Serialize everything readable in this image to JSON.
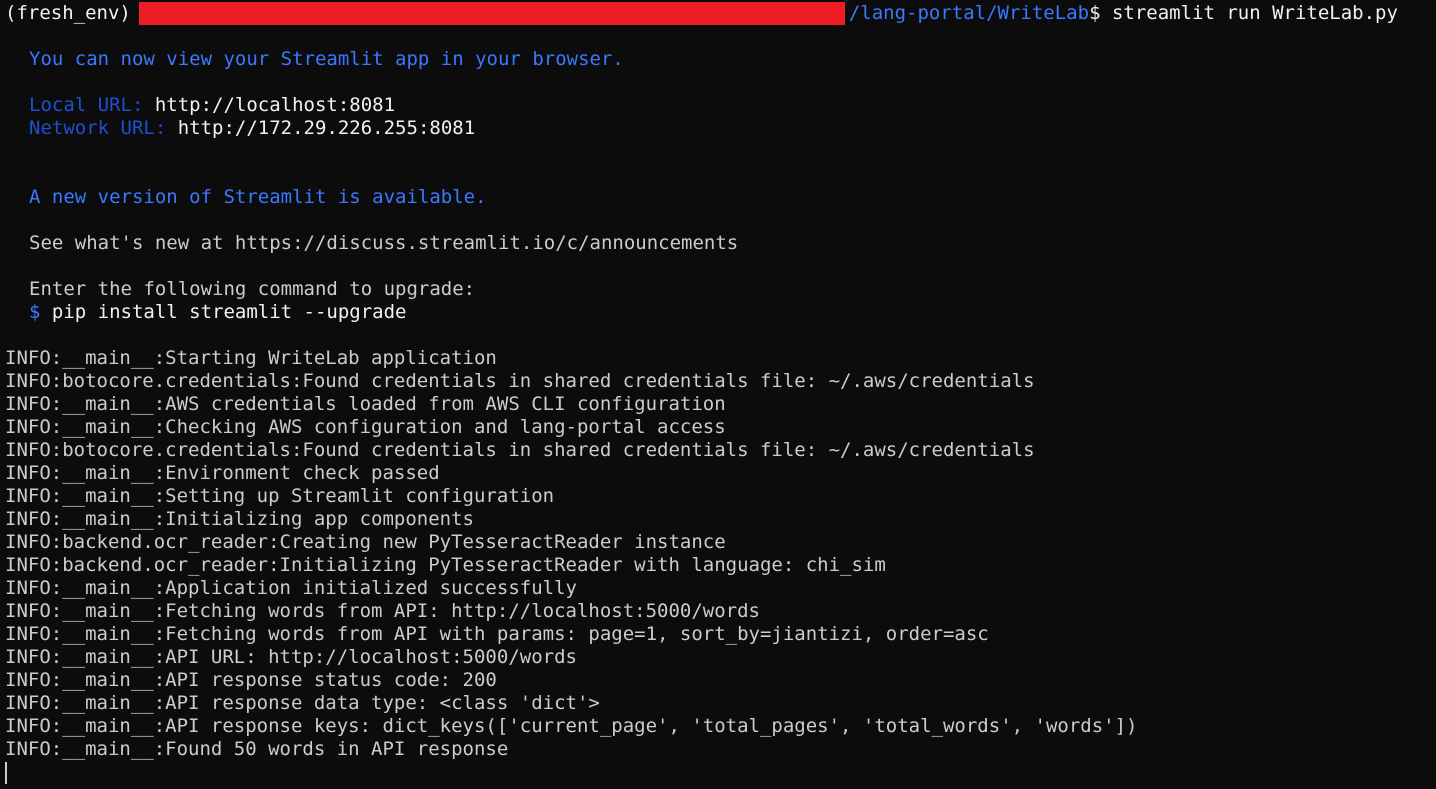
{
  "prompt": {
    "env": "(fresh_env)",
    "path": "/lang-portal/WriteLab",
    "symbol": "$",
    "command": " streamlit run WriteLab.py"
  },
  "streamlit": {
    "view_msg": "You can now view your Streamlit app in your browser.",
    "local_label": "Local URL:",
    "local_url": " http://localhost:8081",
    "network_label": "Network URL:",
    "network_url": " http://172.29.226.255:8081",
    "new_version": "A new version of Streamlit is available.",
    "see_new": "See what's new at https://discuss.streamlit.io/c/announcements",
    "enter_cmd": "Enter the following command to upgrade:",
    "upgrade_symbol": "$",
    "upgrade_cmd": " pip install streamlit --upgrade"
  },
  "logs": [
    "INFO:__main__:Starting WriteLab application",
    "INFO:botocore.credentials:Found credentials in shared credentials file: ~/.aws/credentials",
    "INFO:__main__:AWS credentials loaded from AWS CLI configuration",
    "INFO:__main__:Checking AWS configuration and lang-portal access",
    "INFO:botocore.credentials:Found credentials in shared credentials file: ~/.aws/credentials",
    "INFO:__main__:Environment check passed",
    "INFO:__main__:Setting up Streamlit configuration",
    "INFO:__main__:Initializing app components",
    "INFO:backend.ocr_reader:Creating new PyTesseractReader instance",
    "INFO:backend.ocr_reader:Initializing PyTesseractReader with language: chi_sim",
    "INFO:__main__:Application initialized successfully",
    "INFO:__main__:Fetching words from API: http://localhost:5000/words",
    "INFO:__main__:Fetching words from API with params: page=1, sort_by=jiantizi, order=asc",
    "INFO:__main__:API URL: http://localhost:5000/words",
    "INFO:__main__:API response status code: 200",
    "INFO:__main__:API response data type: <class 'dict'>",
    "INFO:__main__:API response keys: dict_keys(['current_page', 'total_pages', 'total_words', 'words'])",
    "INFO:__main__:Found 50 words in API response"
  ]
}
